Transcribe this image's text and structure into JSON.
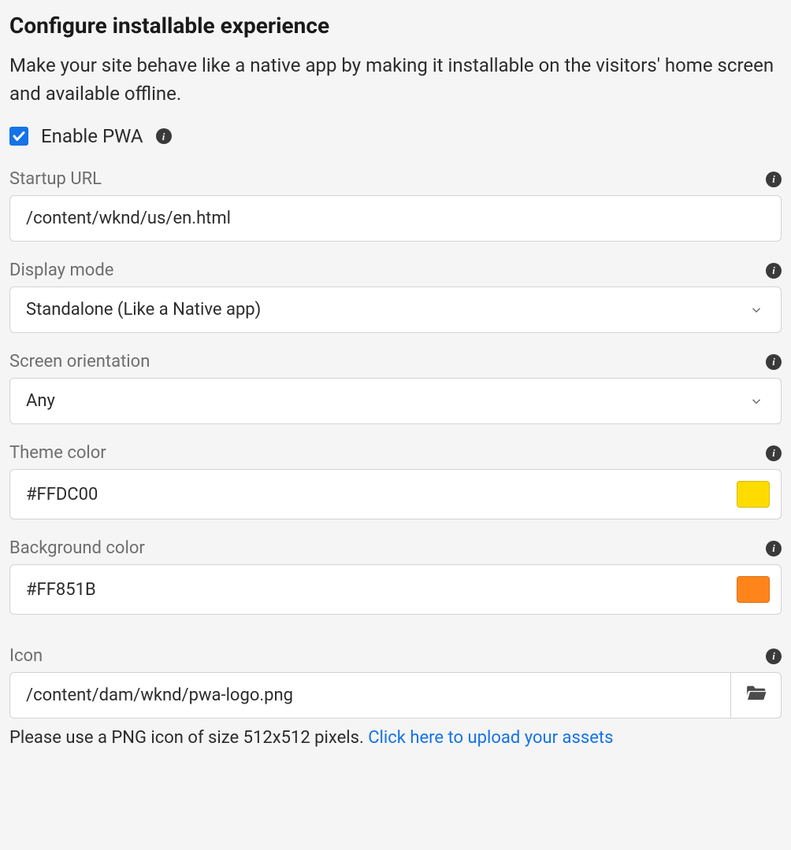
{
  "title": "Configure installable experience",
  "description": "Make your site behave like a native app by making it installable on the visitors' home screen and available offline.",
  "enable": {
    "label": "Enable PWA",
    "checked": true
  },
  "fields": {
    "startup_url": {
      "label": "Startup URL",
      "value": "/content/wknd/us/en.html"
    },
    "display_mode": {
      "label": "Display mode",
      "value": "Standalone (Like a Native app)"
    },
    "screen_orientation": {
      "label": "Screen orientation",
      "value": "Any"
    },
    "theme_color": {
      "label": "Theme color",
      "value": "#FFDC00",
      "swatch": "#FFDC00"
    },
    "background_color": {
      "label": "Background color",
      "value": "#FF851B",
      "swatch": "#FF851B"
    },
    "icon": {
      "label": "Icon",
      "value": "/content/dam/wknd/pwa-logo.png",
      "hint_prefix": "Please use a PNG icon of size 512x512 pixels. ",
      "hint_link": "Click here to upload your assets"
    }
  }
}
